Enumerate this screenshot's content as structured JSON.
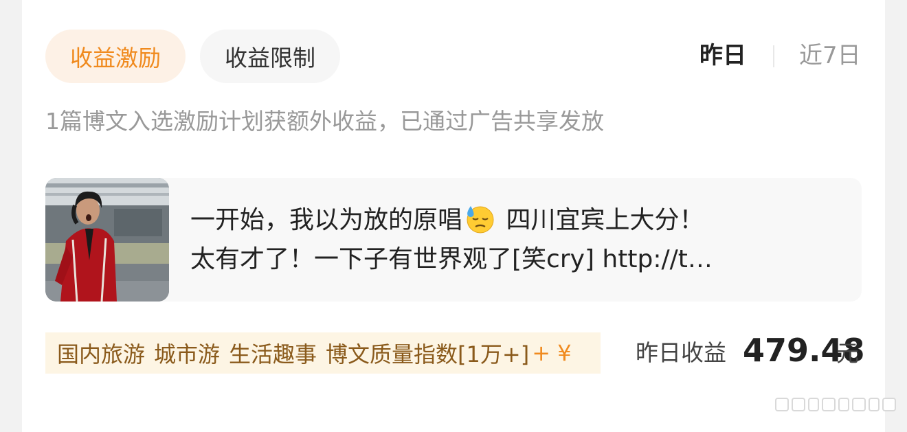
{
  "tabs": [
    {
      "label": "收益激励",
      "active": true
    },
    {
      "label": "收益限制",
      "active": false
    }
  ],
  "period": {
    "yesterday": "昨日",
    "last7days": "近7日"
  },
  "description": "1篇博文入选激励计划获额外收益，已通过广告共享发放",
  "post": {
    "line1_before_emoji": "一开始，我以为放的原唱",
    "emoji": "downcast-face-with-sweat",
    "line1_after_emoji": " 四川宜宾上大分！",
    "line2": "太有才了！一下子有世界观了[笑cry] http://t…",
    "thumbnail": "performer-in-red-jacket"
  },
  "tags": [
    "国内旅游",
    "城市游",
    "生活趣事",
    "博文质量指数[1万+]"
  ],
  "tags_plus": "+ ¥",
  "earnings": {
    "label": "昨日收益",
    "value": "479.48",
    "unit": "元"
  },
  "colors": {
    "accent": "#f08a1e",
    "accent_bg": "#fdf1e6",
    "tag_bg": "#fdf5e4",
    "tag_text": "#8a5a1b"
  }
}
